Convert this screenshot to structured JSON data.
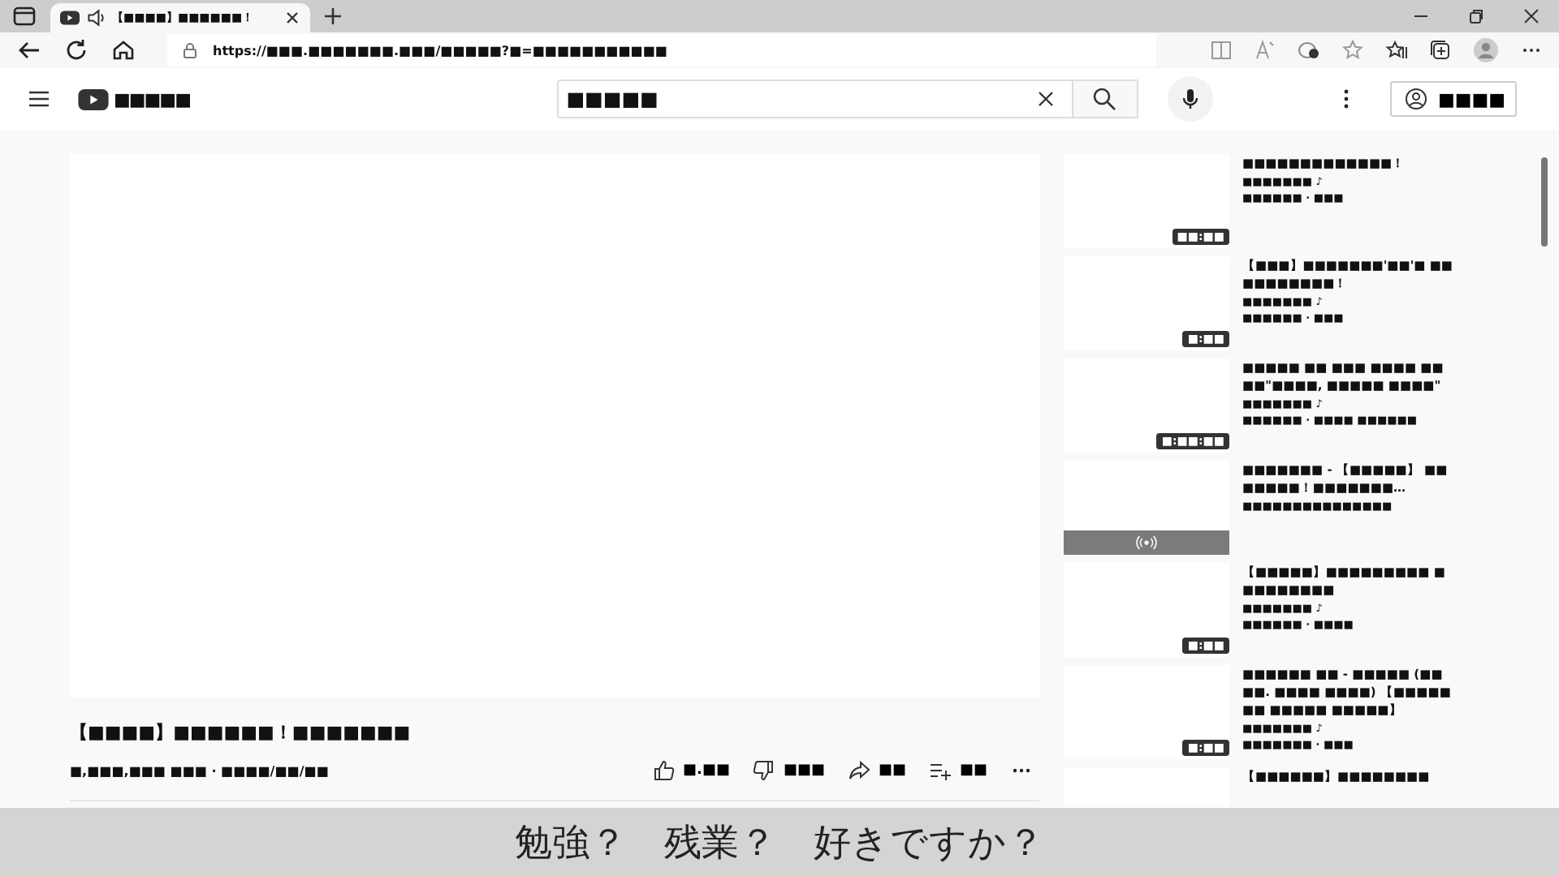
{
  "browser": {
    "tab": {
      "title": "【■■■■】■■■■■■！",
      "playing_audio": true
    },
    "address": "https://■■■.■■■■■■■.■■■/■■■■■?■=■■■■■■■■■■■"
  },
  "header": {
    "logo_text": "■■■■■",
    "search": {
      "value": "■■■■■"
    },
    "sign_in": "■■■■"
  },
  "video": {
    "title": "【■■■■】■■■■■■！■■■■■■■",
    "meta": "■,■■■,■■■ ■■■ · ■■■■/■■/■■",
    "actions": [
      {
        "kind": "like",
        "label": "■.■■"
      },
      {
        "kind": "dislike",
        "label": "■■■"
      },
      {
        "kind": "share",
        "label": "■■"
      },
      {
        "kind": "save",
        "label": "■■"
      }
    ]
  },
  "related": [
    {
      "kind": "video",
      "title": "■■■■■■■■■■■■■！",
      "channel": "■■■■■■■ ♪",
      "meta": "■■■■■■ · ■■■",
      "duration": "■■:■■"
    },
    {
      "kind": "video",
      "title": "【■■■】■■■■■■■'■■'■ ■■■■■■■■■■！",
      "channel": "■■■■■■■ ♪",
      "meta": "■■■■■■ · ■■■",
      "duration": "■:■■"
    },
    {
      "kind": "video",
      "title": "■■■■■ ■■ ■■■ ■■■■ ■■■■\"■■■■, ■■■■■ ■■■■\"",
      "channel": "■■■■■■■ ♪",
      "meta": "■■■■■■ · ■■■■ ■■■■■■",
      "duration": "■:■■:■■"
    },
    {
      "kind": "live",
      "title": "■■■■■■■ - 【■■■■■】 ■■■■■■■！■■■■■■■…",
      "channel": "■■■■■■■■■■■■■■■"
    },
    {
      "kind": "video",
      "title": "【■■■■■】■■■■■■■■■ ■■■■■■■■■",
      "channel": "■■■■■■■ ♪",
      "meta": "■■■■■■ · ■■■■",
      "duration": "■:■■"
    },
    {
      "kind": "video",
      "title": "■■■■■■ ■■ - ■■■■■ (■■■■. ■■■■ ■■■■) 【■■■■■■■ ■■■■■ ■■■■■】",
      "channel": "■■■■■■■ ♪",
      "meta": "■■■■■■■ · ■■■",
      "duration": "■:■■"
    },
    {
      "kind": "video",
      "title": "【■■■■■■】■■■■■■■■"
    }
  ],
  "subtitle": "勉強？　残業？　好きですか？"
}
